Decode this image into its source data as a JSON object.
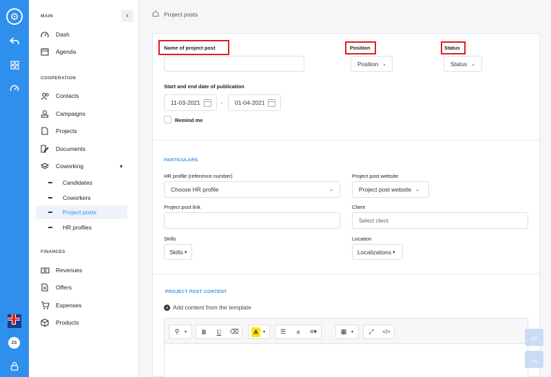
{
  "rail": {
    "avatar_initials": "ZS"
  },
  "sidebar": {
    "sections": {
      "main": "MAIN",
      "cooperation": "COOPERATION",
      "finances": "FINANCES"
    },
    "main_items": [
      "Dash",
      "Agenda"
    ],
    "cooperation_items": [
      "Contacts",
      "Campaigns",
      "Projects",
      "Documents",
      "Coworking"
    ],
    "coworking_sub": [
      "Candidates",
      "Coworkers",
      "Project posts",
      "HR profiles"
    ],
    "active_sub": "Project posts",
    "finance_items": [
      "Revenues",
      "Offers",
      "Expenses",
      "Products"
    ]
  },
  "breadcrumb": "Project posts",
  "form": {
    "name_label": "Name of project post",
    "name_value": "",
    "position_label": "Position",
    "position_value": "Position",
    "status_label": "Status",
    "status_value": "Status",
    "dates_label": "Start and end date of publication",
    "start_date": "11-03-2021",
    "date_sep": "-",
    "end_date": "01-04-2021",
    "remind_label": "Remind me"
  },
  "particulars": {
    "title": "PARTICULARS",
    "hr_label": "HR profile (reference number)",
    "hr_value": "Choose HR profile",
    "website_label": "Project post website",
    "website_value": "Project post website",
    "link_label": "Project post link",
    "link_value": "",
    "client_label": "Client",
    "client_placeholder": "Select client",
    "skills_label": "Skills",
    "skills_value": "Skills",
    "location_label": "Location",
    "location_value": "Localizations"
  },
  "content": {
    "title": "PROJECT POST CONTENT",
    "add_template": "Add content from the template"
  },
  "editor": {
    "bold": "B",
    "underline": "U",
    "highlight": "A",
    "code": "</>"
  },
  "colors": {
    "primary": "#2f8fec",
    "highlight_box": "#e01b24"
  }
}
